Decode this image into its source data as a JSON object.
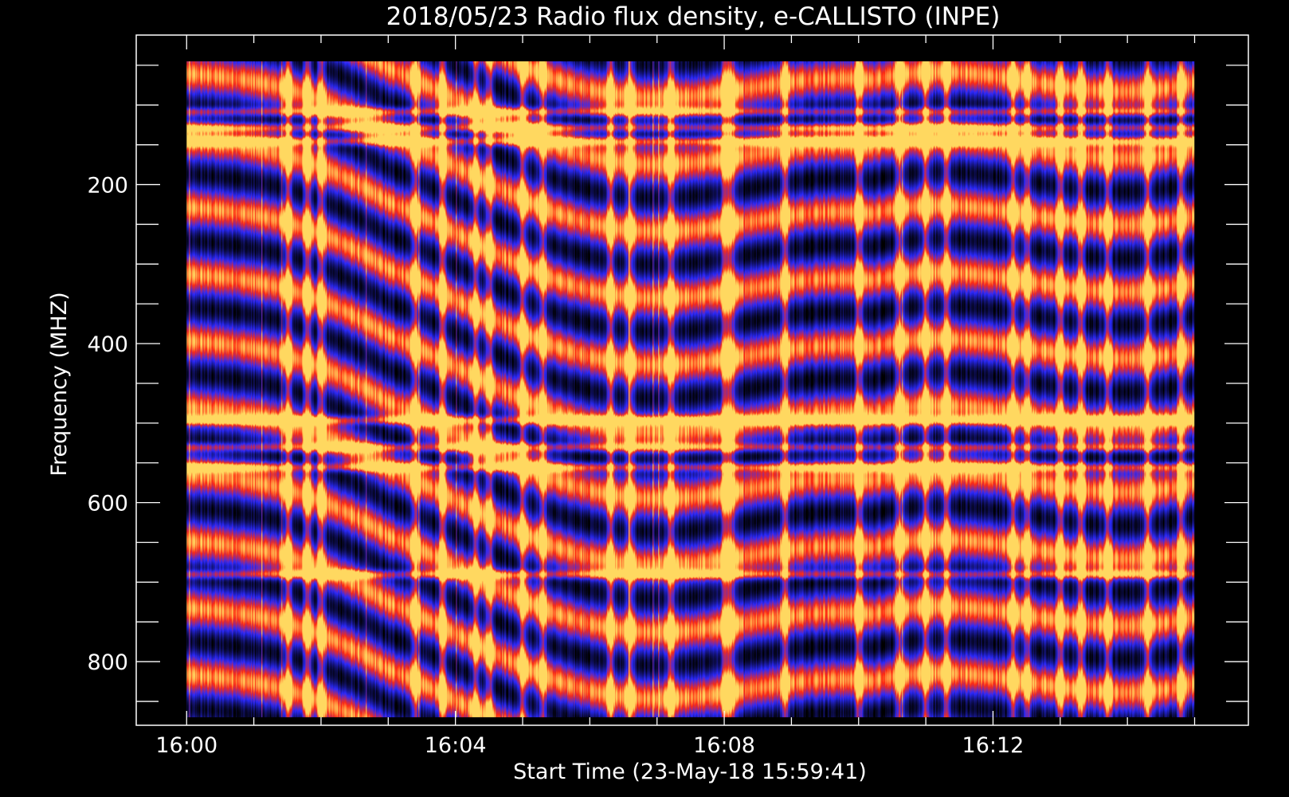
{
  "chart_data": {
    "type": "heatmap",
    "title": "2018/05/23  Radio flux density, e-CALLISTO (INPE)",
    "xlabel": "Start Time (23-May-18 15:59:41)",
    "ylabel": "Frequency (MHZ)",
    "x_tick_labels": [
      "16:00",
      "16:04",
      "16:08",
      "16:12"
    ],
    "y_tick_labels": [
      "200",
      "400",
      "600",
      "800"
    ],
    "x_range_minutes_after_1600": [
      -0.75,
      15.8
    ],
    "data_x_range_minutes_after_1600": [
      0.0,
      15.0
    ],
    "y_range_mhz": [
      12,
      880
    ],
    "data_y_range_mhz": [
      45,
      870
    ],
    "y_reversed": true,
    "colors": {
      "background": "#000000",
      "axis": "#ffffff",
      "low": "#000000",
      "mid": "#2a2aff",
      "high": "#ff2a10",
      "peak": "#ffd860"
    },
    "interference_bands_mhz": [
      108,
      128,
      145,
      496,
      530,
      555,
      690
    ],
    "burst_columns_minutes_after_1600": [
      1.5,
      1.8,
      2.0,
      3.4,
      3.8,
      4.3,
      4.5,
      5.0,
      5.3,
      6.3,
      6.6,
      7.2,
      8.0,
      8.1,
      8.9,
      10.0,
      10.6,
      11.0,
      11.3,
      12.3,
      12.5,
      13.0,
      13.3,
      13.7,
      14.3,
      14.8
    ]
  }
}
